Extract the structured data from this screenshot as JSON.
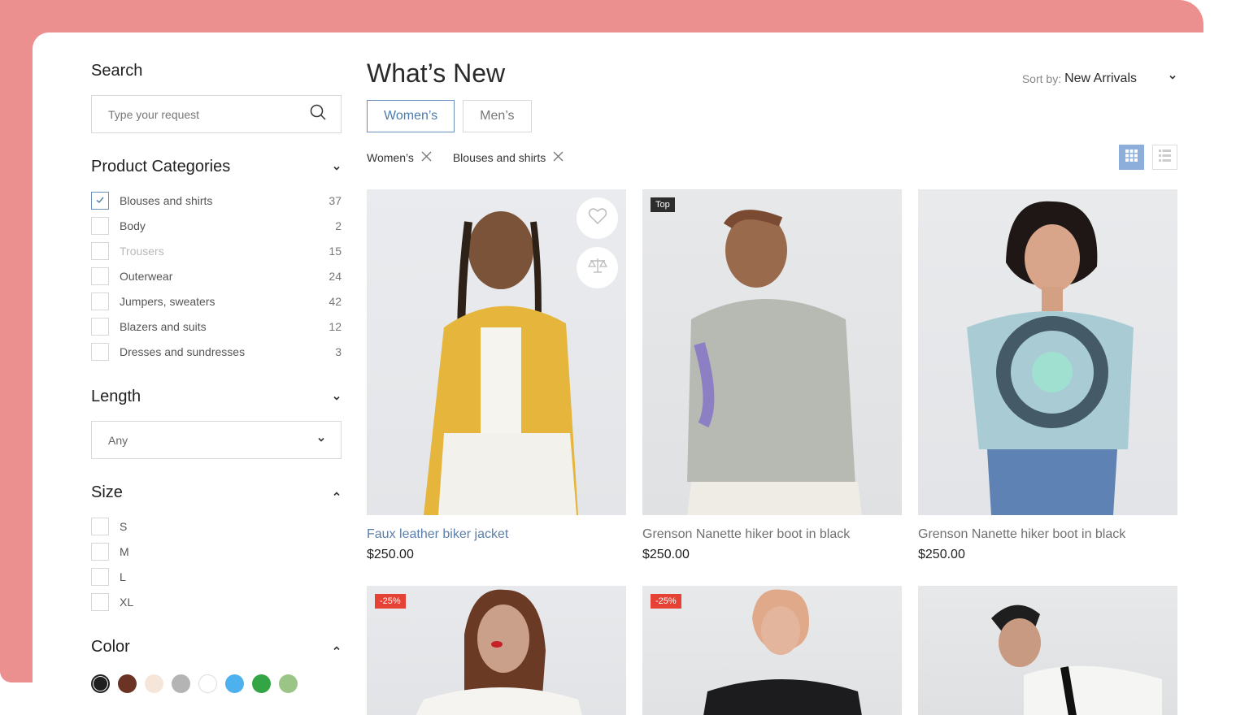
{
  "sidebar": {
    "search": {
      "title": "Search",
      "placeholder": "Type your request"
    },
    "categories": {
      "title": "Product Categories",
      "items": [
        {
          "label": "Blouses and shirts",
          "count": "37",
          "checked": true
        },
        {
          "label": "Body",
          "count": "2",
          "checked": false
        },
        {
          "label": "Trousers",
          "count": "15",
          "checked": false,
          "muted": true
        },
        {
          "label": "Outerwear",
          "count": "24",
          "checked": false
        },
        {
          "label": "Jumpers, sweaters",
          "count": "42",
          "checked": false
        },
        {
          "label": "Blazers and suits",
          "count": "12",
          "checked": false
        },
        {
          "label": "Dresses and sundresses",
          "count": "3",
          "checked": false
        }
      ]
    },
    "length": {
      "title": "Length",
      "value": "Any"
    },
    "size": {
      "title": "Size",
      "options": [
        "S",
        "M",
        "L",
        "XL"
      ]
    },
    "color": {
      "title": "Color",
      "swatches": [
        "#1f1f1f",
        "#6b3324",
        "#f6e6d9",
        "#b4b4b4",
        "#ffffff",
        "#4cb1ec",
        "#34a544",
        "#9bc587"
      ]
    }
  },
  "main": {
    "title": "What’s New",
    "sort": {
      "label": "Sort by:",
      "value": "New Arrivals"
    },
    "tabs": [
      {
        "label": "Women’s",
        "active": true
      },
      {
        "label": "Men’s",
        "active": false
      }
    ],
    "filters": [
      "Women’s",
      "Blouses and shirts"
    ],
    "products": [
      {
        "name": "Faux leather biker jacket",
        "price": "$250.00",
        "badge": "",
        "highlight": true,
        "tone": "yellow"
      },
      {
        "name": "Grenson Nanette hiker boot in black",
        "price": "$250.00",
        "badge": "Top",
        "highlight": false,
        "tone": "grey"
      },
      {
        "name": "Grenson Nanette hiker boot in black",
        "price": "$250.00",
        "badge": "",
        "highlight": false,
        "tone": "tiedye"
      },
      {
        "name": "",
        "price": "",
        "badge": "-25%",
        "tone": "white"
      },
      {
        "name": "",
        "price": "",
        "badge": "-25%",
        "tone": "black"
      },
      {
        "name": "",
        "price": "",
        "badge": "",
        "tone": "mono"
      }
    ]
  }
}
